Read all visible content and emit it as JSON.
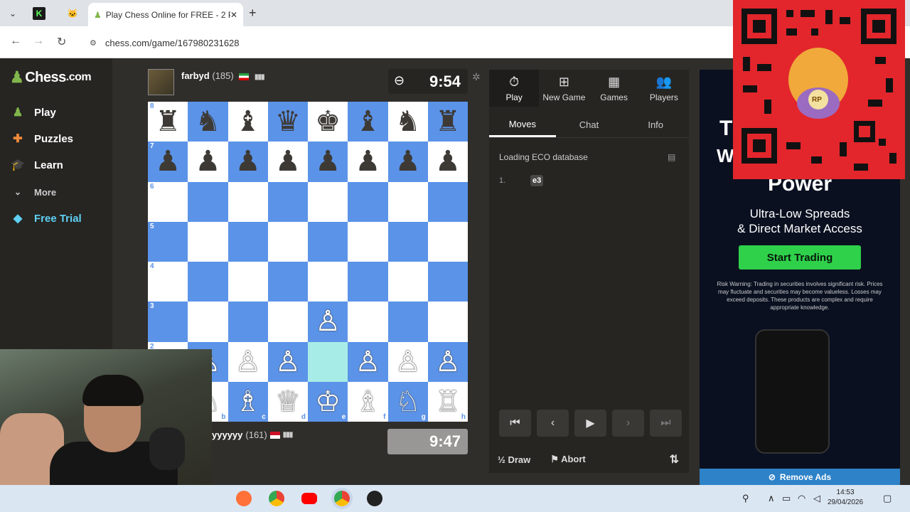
{
  "browser": {
    "tab_title": "Play Chess Online for FREE - 2 P",
    "url": "chess.com/game/167980231628",
    "new_tab_symbol": "+",
    "close_symbol": "✕"
  },
  "sidebar": {
    "logo_text": "Chess",
    "logo_suffix": ".com",
    "items": [
      {
        "label": "Play",
        "icon": "pawn-icon"
      },
      {
        "label": "Puzzles",
        "icon": "puzzle-icon"
      },
      {
        "label": "Learn",
        "icon": "graduation-icon"
      },
      {
        "label": "More",
        "icon": "chevron-down-icon"
      },
      {
        "label": "Free Trial",
        "icon": "diamond-icon"
      }
    ]
  },
  "top_player": {
    "name": "farbyd",
    "rating": "(185)",
    "clock": "9:54"
  },
  "bottom_player": {
    "name": "yyyyyy",
    "rating": "(161)",
    "clock": "9:47"
  },
  "board": {
    "ranks": [
      "8",
      "7",
      "6",
      "5",
      "4",
      "3",
      "2",
      "1"
    ],
    "files": [
      "a",
      "b",
      "c",
      "d",
      "e",
      "f",
      "g",
      "h"
    ],
    "rows": [
      [
        "♜",
        "♞",
        "♝",
        "♛",
        "♚",
        "♝",
        "♞",
        "♜"
      ],
      [
        "♟",
        "♟",
        "♟",
        "♟",
        "♟",
        "♟",
        "♟",
        "♟"
      ],
      [
        "",
        "",
        "",
        "",
        "",
        "",
        "",
        ""
      ],
      [
        "",
        "",
        "",
        "",
        "",
        "",
        "",
        ""
      ],
      [
        "",
        "",
        "",
        "",
        "",
        "",
        "",
        ""
      ],
      [
        "",
        "",
        "",
        "",
        "♙",
        "",
        "",
        ""
      ],
      [
        "♙",
        "♙",
        "♙",
        "♙",
        "",
        "♙",
        "♙",
        "♙"
      ],
      [
        "♖",
        "♘",
        "♗",
        "♕",
        "♔",
        "♗",
        "♘",
        "♖"
      ]
    ]
  },
  "panel": {
    "top_tabs": [
      {
        "label": "Play",
        "icon": "stopwatch-icon"
      },
      {
        "label": "New Game",
        "icon": "plus-square-icon"
      },
      {
        "label": "Games",
        "icon": "board-icon"
      },
      {
        "label": "Players",
        "icon": "people-icon"
      }
    ],
    "sub_tabs": [
      "Moves",
      "Chat",
      "Info"
    ],
    "eco_text": "Loading ECO database",
    "move_number": "1.",
    "move": "e3",
    "draw_label": "Draw",
    "abort_label": "Abort",
    "half_symbol": "½"
  },
  "ad": {
    "headline_partial_1": "T",
    "headline_partial_2": "W",
    "headline": "Power",
    "subtitle_line1": "Ultra-Low Spreads",
    "subtitle_line2": "& Direct Market Access",
    "cta": "Start Trading",
    "warning": "Risk Warning: Trading in securities involves significant risk. Prices may fluctuate and securities may become valueless. Losses may exceed deposits. These products are complex and require appropriate knowledge.",
    "remove_ads": "Remove Ads"
  },
  "qr": {
    "badge": "RP"
  },
  "taskbar": {
    "time": "14:53",
    "date": "29/04/2026"
  },
  "colors": {
    "board_dark": "#5b93e8",
    "board_light": "#ffffff",
    "highlight": "#a8ece8",
    "cta_green": "#2fd14b",
    "qr_red": "#e2262c"
  }
}
